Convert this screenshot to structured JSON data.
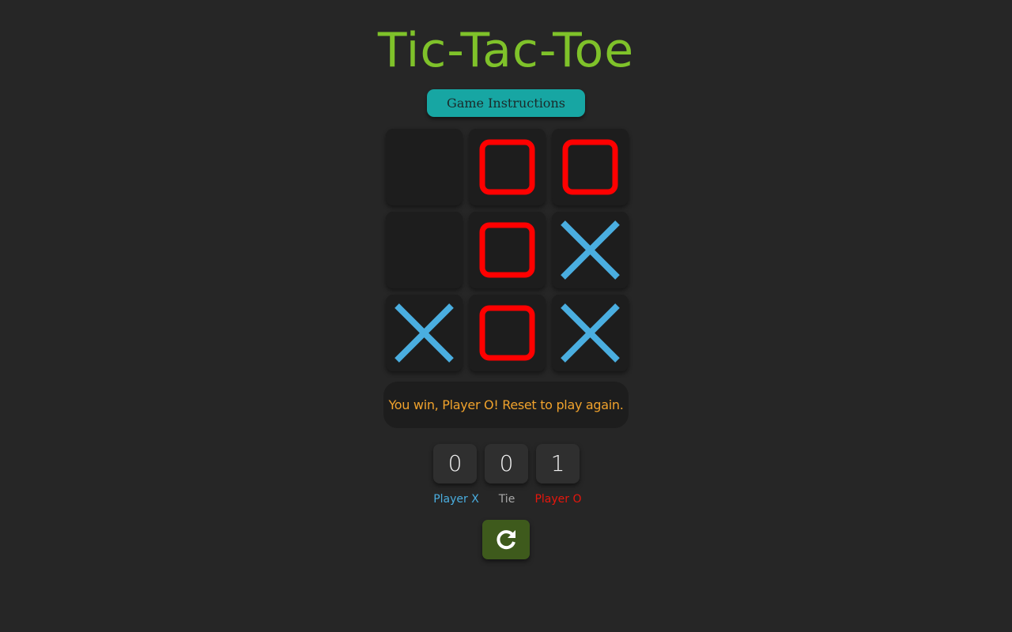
{
  "game": {
    "title": "Tic-Tac-Toe",
    "instructions_label": "Game Instructions",
    "status_message": "You win, Player O! Reset to play again.",
    "board": [
      "",
      "O",
      "O",
      "",
      "O",
      "X",
      "X",
      "O",
      "X"
    ],
    "scores": [
      {
        "id": "x",
        "label": "Player X",
        "value": "0",
        "color": "#4aaee0"
      },
      {
        "id": "tie",
        "label": "Tie",
        "value": "0",
        "color": "#a8a8a8"
      },
      {
        "id": "o",
        "label": "Player O",
        "value": "1",
        "color": "#e8160c"
      }
    ],
    "reset_icon": "refresh-icon"
  },
  "colors": {
    "background": "#262626",
    "title": "#7fc22a",
    "instructions_button": "#17a6a3",
    "cell": "#1d1d1d",
    "x_mark": "#4aaee0",
    "o_mark": "#ff0000",
    "status_text": "#f0a22c",
    "reset_button": "#3e5a1c"
  }
}
